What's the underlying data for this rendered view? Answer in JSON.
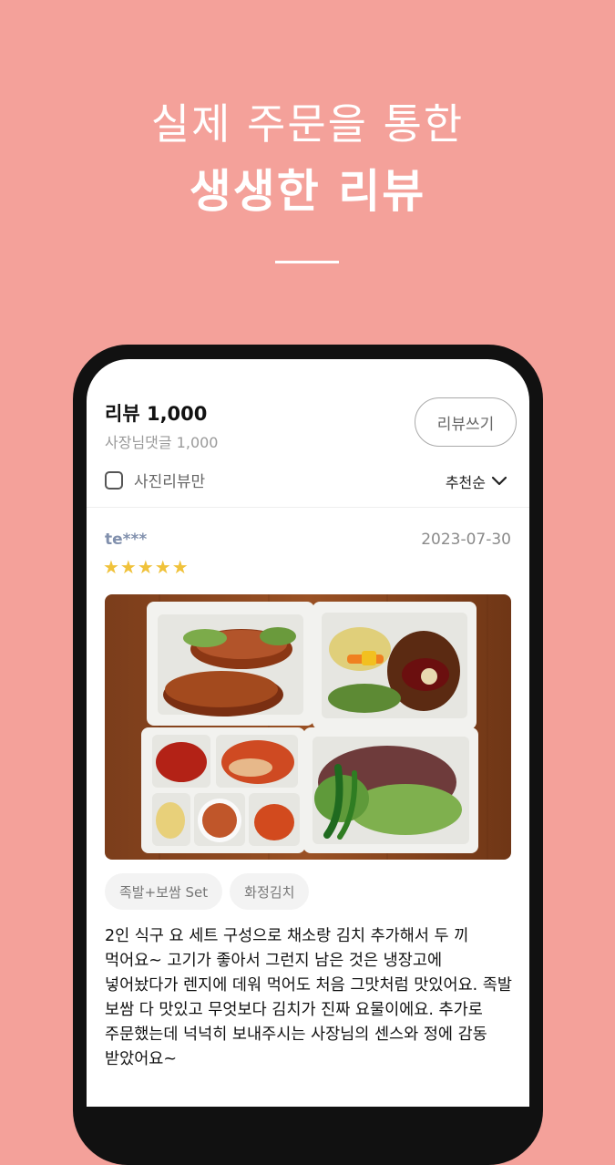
{
  "header": {
    "line1": "실제 주문을 통한",
    "line2": "생생한 리뷰"
  },
  "review_summary": {
    "title": "리뷰 1,000",
    "owner_reply": "사장님댓글 1,000",
    "write_button": "리뷰쓰기",
    "photo_only_label": "사진리뷰만",
    "photo_only_checked": false,
    "sort_label": "추천순"
  },
  "review": {
    "author": "te***",
    "date": "2023-07-30",
    "rating": 5,
    "stars_text": "★★★★★",
    "photo_icon": "food-photo",
    "tags": [
      "족발+보쌈 Set",
      "화정김치"
    ],
    "text": "2인 식구 요 세트 구성으로 채소랑 김치 추가해서 두 끼 먹어요~ 고기가 좋아서 그런지 남은 것은 냉장고에 넣어놨다가 렌지에 데워 먹어도 처음 그맛처럼 맛있어요. 족발 보쌈 다 맛있고 무엇보다 김치가 진짜 요물이에요. 추가로 주문했는데 넉넉히 보내주시는 사장님의 센스와 정에 감동 받았어요~"
  },
  "colors": {
    "background": "#f4a19a",
    "star": "#f0c23a",
    "author": "#8190ad"
  }
}
